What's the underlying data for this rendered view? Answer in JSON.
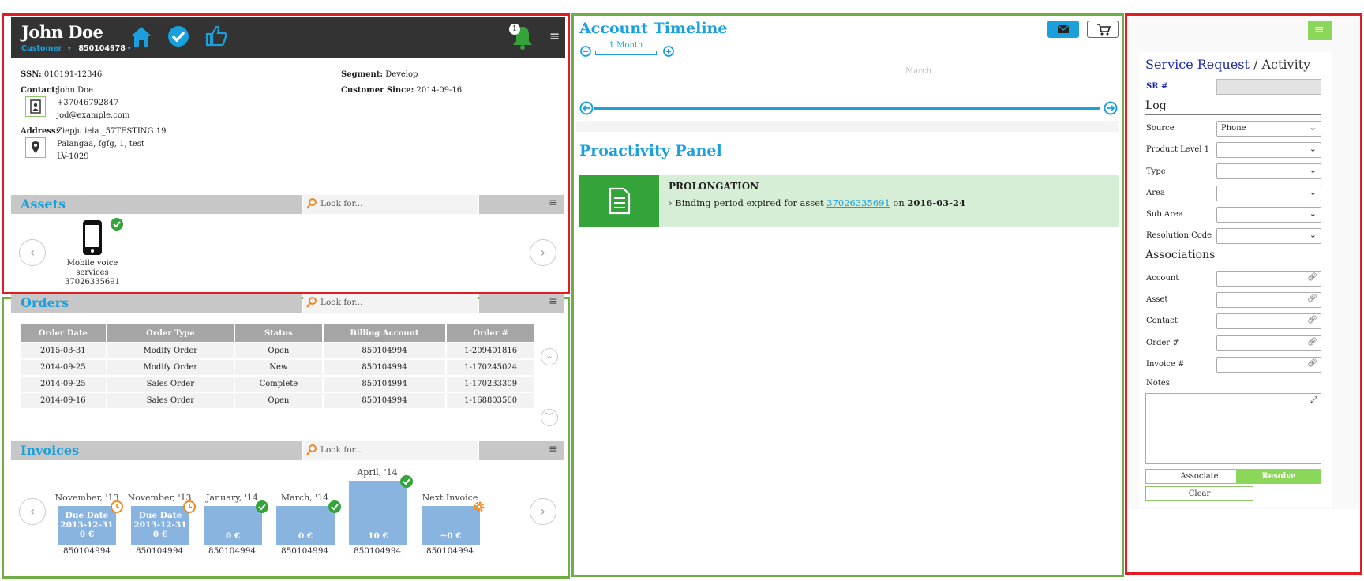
{
  "customer": {
    "name": "John Doe",
    "type": "Customer",
    "account": "850104978",
    "notifications": "1",
    "ssn_label": "SSN:",
    "ssn": "010191-12346",
    "segment_label": "Segment:",
    "segment": "Develop",
    "contact_label": "Contact:",
    "contact_name": "John Doe",
    "phone": "+37046792847",
    "email": "jod@example.com",
    "since_label": "Customer Since:",
    "since": "2014-09-16",
    "address_label": "Address:",
    "address_1": "Ziepju iela _57TESTING 19",
    "address_2": "Palangaa, fgfg, 1, test",
    "address_3": "LV-1029"
  },
  "assets": {
    "title": "Assets",
    "search_placeholder": "Look for...",
    "item_label_1": "Mobile voice",
    "item_label_2": "services",
    "item_number": "37026335691"
  },
  "orders": {
    "title": "Orders",
    "search_placeholder": "Look for...",
    "columns": [
      "Order Date",
      "Order Type",
      "Status",
      "Billing Account",
      "Order #"
    ],
    "rows": [
      [
        "2015-03-31",
        "Modify Order",
        "Open",
        "850104994",
        "1-209401816"
      ],
      [
        "2014-09-25",
        "Modify Order",
        "New",
        "850104994",
        "1-170245024"
      ],
      [
        "2014-09-25",
        "Sales Order",
        "Complete",
        "850104994",
        "1-170233309"
      ],
      [
        "2014-09-16",
        "Sales Order",
        "Open",
        "850104994",
        "1-168803560"
      ]
    ]
  },
  "invoices": {
    "title": "Invoices",
    "search_placeholder": "Look for...",
    "items": [
      {
        "period": "November, '13",
        "line1": "Due Date",
        "line2": "2013-12-31",
        "amount": "0 €",
        "account": "850104994",
        "status": "pending"
      },
      {
        "period": "November, '13",
        "line1": "Due Date",
        "line2": "2013-12-31",
        "amount": "0 €",
        "account": "850104994",
        "status": "pending"
      },
      {
        "period": "January, '14",
        "amount": "0 €",
        "account": "850104994",
        "status": "paid"
      },
      {
        "period": "March, '14",
        "amount": "0 €",
        "account": "850104994",
        "status": "paid"
      },
      {
        "period": "April, '14",
        "amount": "10 €",
        "account": "850104994",
        "status": "paid"
      },
      {
        "period": "Next Invoice",
        "amount": "~0 €",
        "account": "850104994",
        "status": "upcoming"
      }
    ]
  },
  "timeline": {
    "title": "Account Timeline",
    "zoom_label": "1 Month",
    "month_label": "March"
  },
  "proactivity": {
    "title": "Proactivity Panel",
    "card_title": "PROLONGATION",
    "text_prefix": "Binding period expired for asset",
    "asset_link": "37026335691",
    "text_mid": "on",
    "date": "2016-03-24"
  },
  "service_request": {
    "title_a": "Service Request",
    "title_sep": " / ",
    "title_b": "Activity",
    "sr_label": "SR #",
    "log_title": "Log",
    "source_label": "Source",
    "source_value": "Phone",
    "product_label": "Product Level 1",
    "type_label": "Type",
    "area_label": "Area",
    "subarea_label": "Sub Area",
    "resolution_label": "Resolution Code",
    "assoc_title": "Associations",
    "account_label": "Account",
    "asset_label": "Asset",
    "contact_label": "Contact",
    "order_label": "Order #",
    "invoice_label": "Invoice #",
    "notes_label": "Notes",
    "associate_button": "Associate",
    "resolve_button": "Resolve",
    "clear_button": "Clear"
  },
  "colors": {
    "accent_blue": "#19a0dd",
    "frame_red": "#e31b23",
    "frame_green": "#6fad47",
    "header_dark": "#333333",
    "invoice_blue": "#8ab4e0",
    "success_green": "#33a33a"
  }
}
